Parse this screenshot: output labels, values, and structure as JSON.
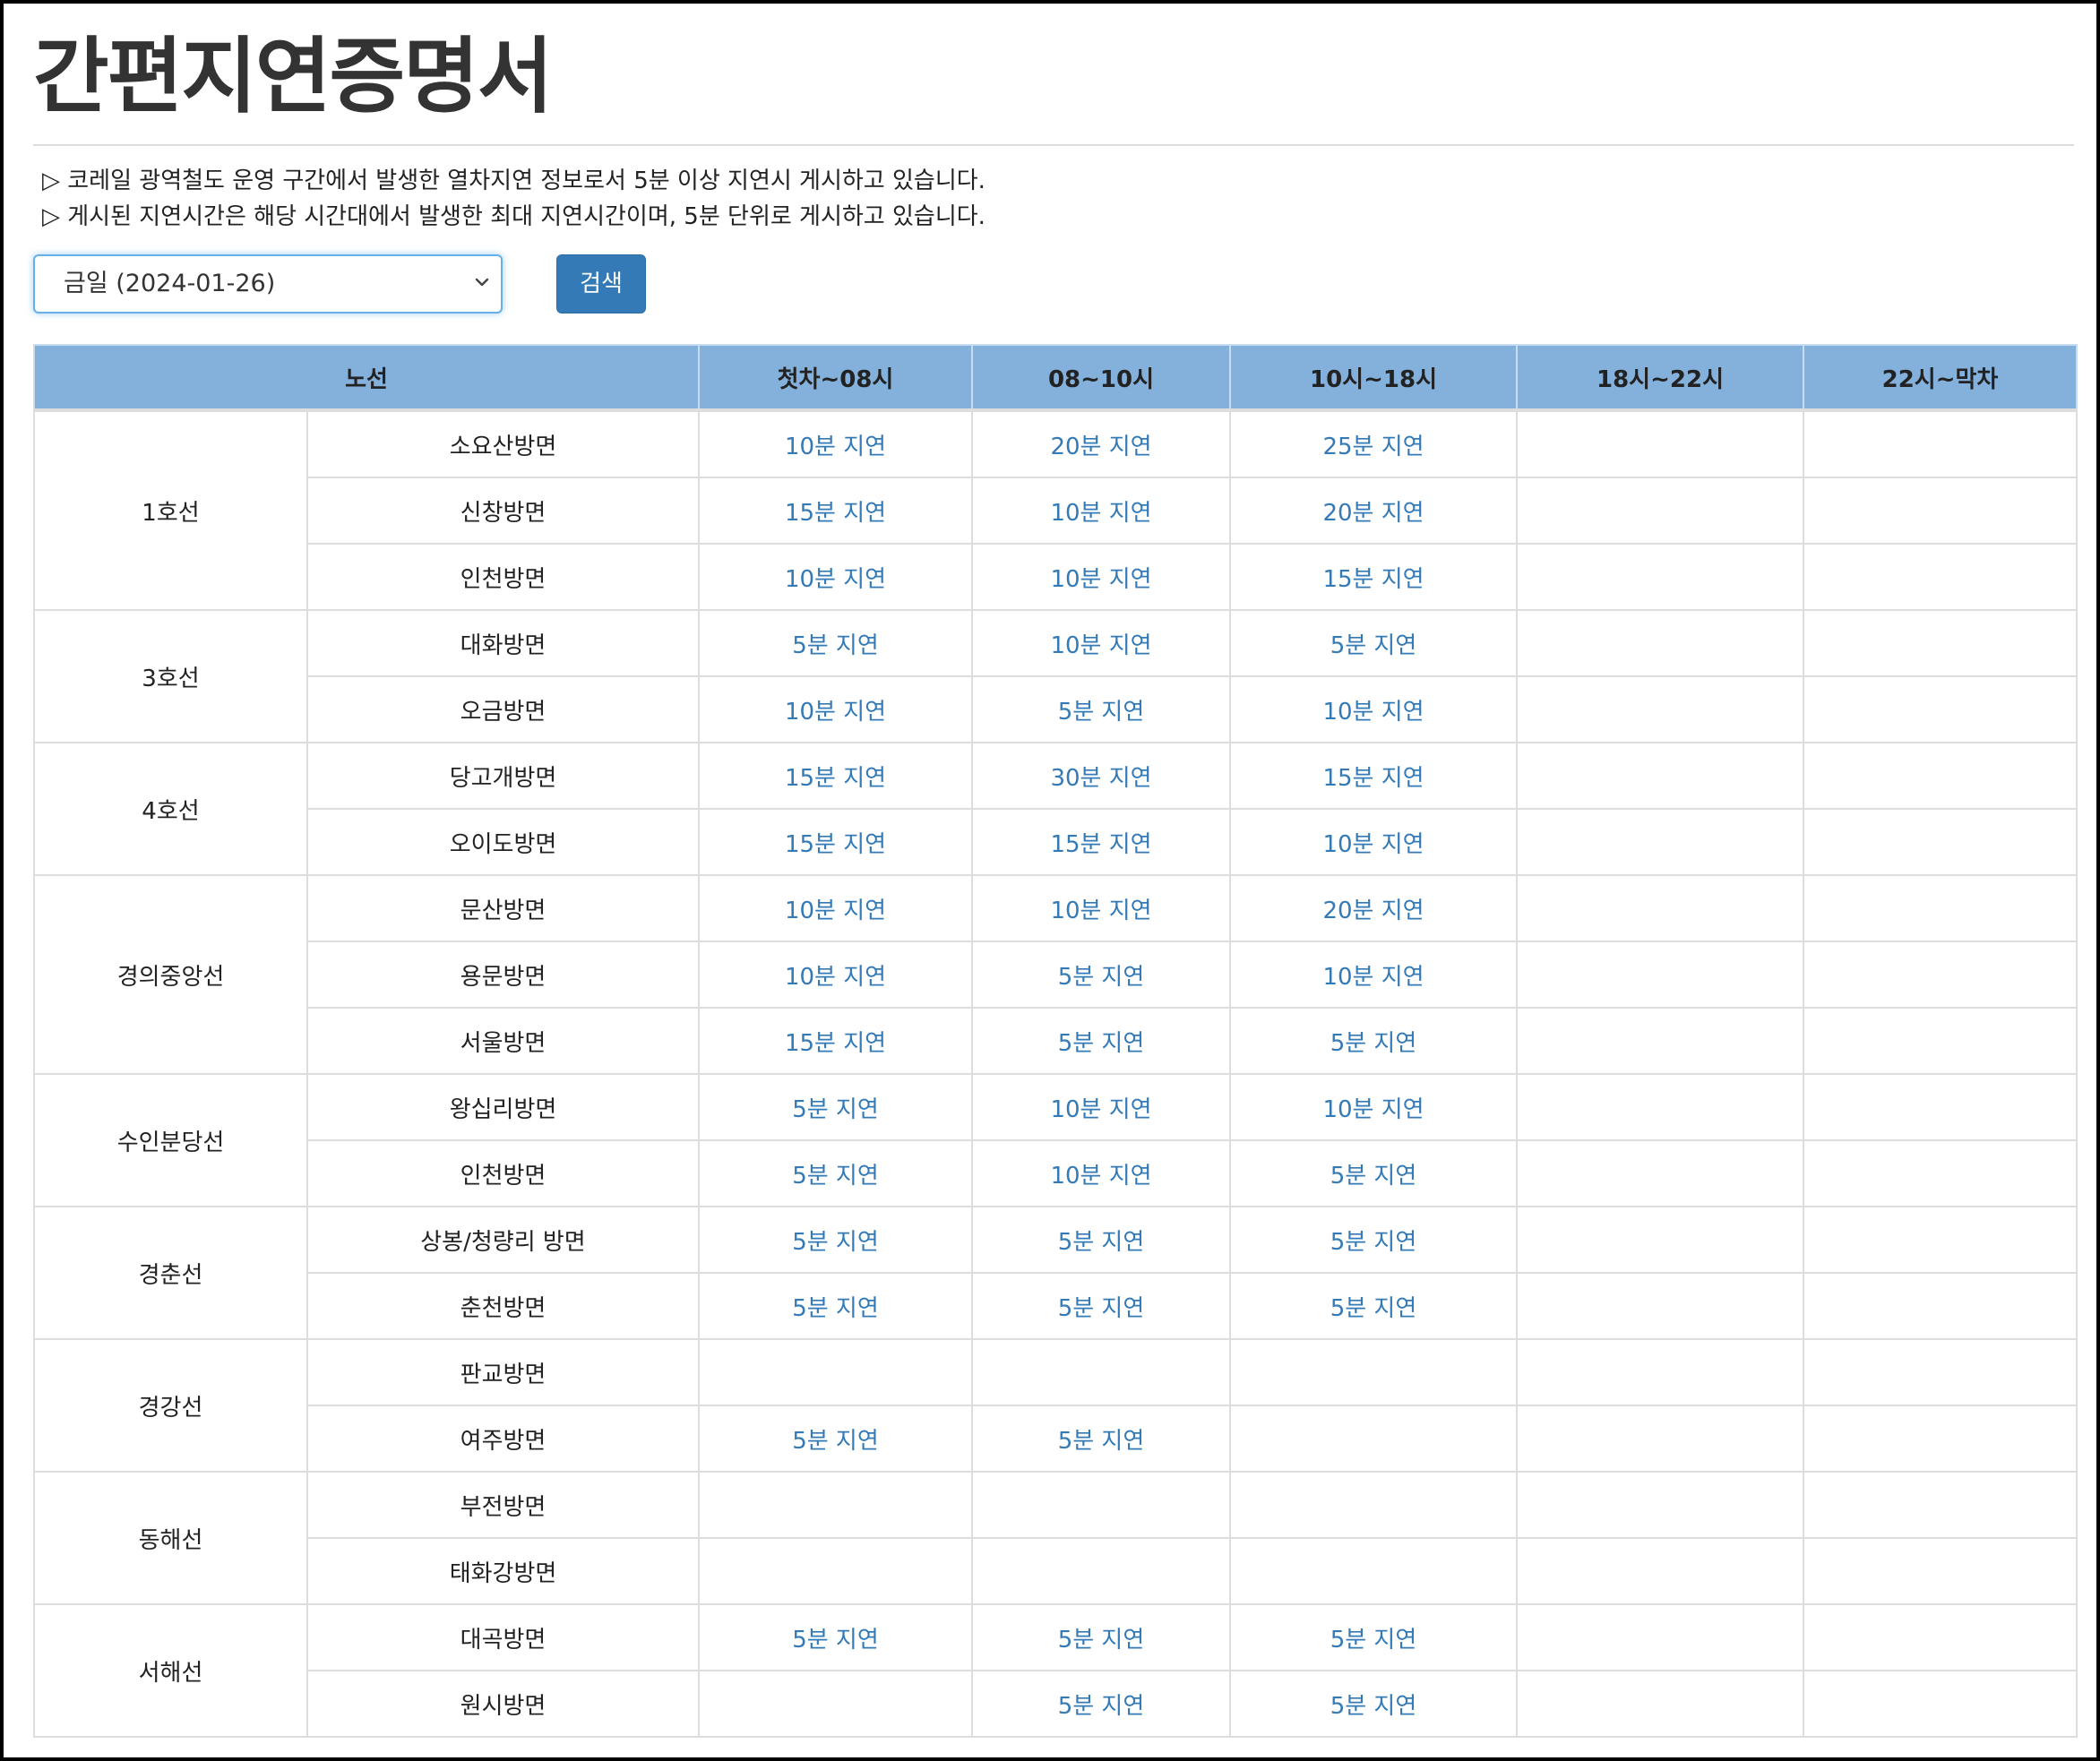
{
  "page": {
    "title": "간편지연증명서",
    "notices": [
      "▷ 코레일 광역철도 운영 구간에서 발생한 열차지연 정보로서 5분 이상 지연시 게시하고 있습니다.",
      "▷ 게시된 지연시간은 해당 시간대에서 발생한 최대 지연시간이며, 5분 단위로 게시하고 있습니다."
    ]
  },
  "search": {
    "date_value": "금일 (2024-01-26)",
    "button_label": "검색"
  },
  "table": {
    "headers": [
      "노선",
      "첫차~08시",
      "08~10시",
      "10시~18시",
      "18시~22시",
      "22시~막차"
    ],
    "lines": [
      {
        "name": "1호선",
        "directions": [
          {
            "name": "소요산방면",
            "delays": [
              "10분 지연",
              "20분 지연",
              "25분 지연",
              "",
              ""
            ]
          },
          {
            "name": "신창방면",
            "delays": [
              "15분 지연",
              "10분 지연",
              "20분 지연",
              "",
              ""
            ]
          },
          {
            "name": "인천방면",
            "delays": [
              "10분 지연",
              "10분 지연",
              "15분 지연",
              "",
              ""
            ]
          }
        ]
      },
      {
        "name": "3호선",
        "directions": [
          {
            "name": "대화방면",
            "delays": [
              "5분 지연",
              "10분 지연",
              "5분 지연",
              "",
              ""
            ]
          },
          {
            "name": "오금방면",
            "delays": [
              "10분 지연",
              "5분 지연",
              "10분 지연",
              "",
              ""
            ]
          }
        ]
      },
      {
        "name": "4호선",
        "directions": [
          {
            "name": "당고개방면",
            "delays": [
              "15분 지연",
              "30분 지연",
              "15분 지연",
              "",
              ""
            ]
          },
          {
            "name": "오이도방면",
            "delays": [
              "15분 지연",
              "15분 지연",
              "10분 지연",
              "",
              ""
            ]
          }
        ]
      },
      {
        "name": "경의중앙선",
        "directions": [
          {
            "name": "문산방면",
            "delays": [
              "10분 지연",
              "10분 지연",
              "20분 지연",
              "",
              ""
            ]
          },
          {
            "name": "용문방면",
            "delays": [
              "10분 지연",
              "5분 지연",
              "10분 지연",
              "",
              ""
            ]
          },
          {
            "name": "서울방면",
            "delays": [
              "15분 지연",
              "5분 지연",
              "5분 지연",
              "",
              ""
            ]
          }
        ]
      },
      {
        "name": "수인분당선",
        "directions": [
          {
            "name": "왕십리방면",
            "delays": [
              "5분 지연",
              "10분 지연",
              "10분 지연",
              "",
              ""
            ]
          },
          {
            "name": "인천방면",
            "delays": [
              "5분 지연",
              "10분 지연",
              "5분 지연",
              "",
              ""
            ]
          }
        ]
      },
      {
        "name": "경춘선",
        "directions": [
          {
            "name": "상봉/청량리 방면",
            "delays": [
              "5분 지연",
              "5분 지연",
              "5분 지연",
              "",
              ""
            ]
          },
          {
            "name": "춘천방면",
            "delays": [
              "5분 지연",
              "5분 지연",
              "5분 지연",
              "",
              ""
            ]
          }
        ]
      },
      {
        "name": "경강선",
        "directions": [
          {
            "name": "판교방면",
            "delays": [
              "",
              "",
              "",
              "",
              ""
            ]
          },
          {
            "name": "여주방면",
            "delays": [
              "5분 지연",
              "5분 지연",
              "",
              "",
              ""
            ]
          }
        ]
      },
      {
        "name": "동해선",
        "directions": [
          {
            "name": "부전방면",
            "delays": [
              "",
              "",
              "",
              "",
              ""
            ]
          },
          {
            "name": "태화강방면",
            "delays": [
              "",
              "",
              "",
              "",
              ""
            ]
          }
        ]
      },
      {
        "name": "서해선",
        "directions": [
          {
            "name": "대곡방면",
            "delays": [
              "5분 지연",
              "5분 지연",
              "5분 지연",
              "",
              ""
            ]
          },
          {
            "name": "원시방면",
            "delays": [
              "",
              "5분 지연",
              "5분 지연",
              "",
              ""
            ]
          }
        ]
      }
    ]
  },
  "colors": {
    "header_bg": "#84b1dc",
    "delay_text": "#337ab7",
    "button_bg": "#337ab7"
  }
}
